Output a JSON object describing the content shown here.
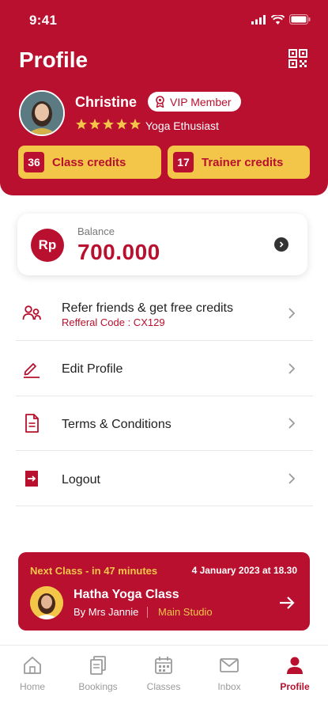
{
  "status_bar": {
    "time": "9:41"
  },
  "header": {
    "title": "Profile",
    "user": {
      "name": "Christine",
      "badge": "VIP Member",
      "subtitle": "Yoga Ethusiast",
      "rating": 5
    },
    "credits": [
      {
        "count": "36",
        "label": "Class credits"
      },
      {
        "count": "17",
        "label": "Trainer credits"
      }
    ]
  },
  "balance": {
    "currency_badge": "Rp",
    "label": "Balance",
    "value": "700.000"
  },
  "menu": [
    {
      "label": "Refer friends & get free credits",
      "sub": "Refferal Code : CX129",
      "icon": "users-icon"
    },
    {
      "label": "Edit Profile",
      "icon": "pencil-icon"
    },
    {
      "label": "Terms & Conditions",
      "icon": "document-icon"
    },
    {
      "label": "Logout",
      "icon": "logout-icon"
    }
  ],
  "next_class": {
    "heading": "Next Class - in 47 minutes",
    "date": "4 January 2023 at 18.30",
    "title": "Hatha Yoga Class",
    "trainer": "By Mrs Jannie",
    "studio": "Main Studio"
  },
  "bottom_nav": [
    {
      "label": "Home",
      "icon": "home-icon"
    },
    {
      "label": "Bookings",
      "icon": "bookings-icon"
    },
    {
      "label": "Classes",
      "icon": "calendar-icon"
    },
    {
      "label": "Inbox",
      "icon": "mail-icon"
    },
    {
      "label": "Profile",
      "icon": "person-icon",
      "active": true
    }
  ],
  "colors": {
    "primary": "#b8102e",
    "accent": "#f3c64a"
  }
}
